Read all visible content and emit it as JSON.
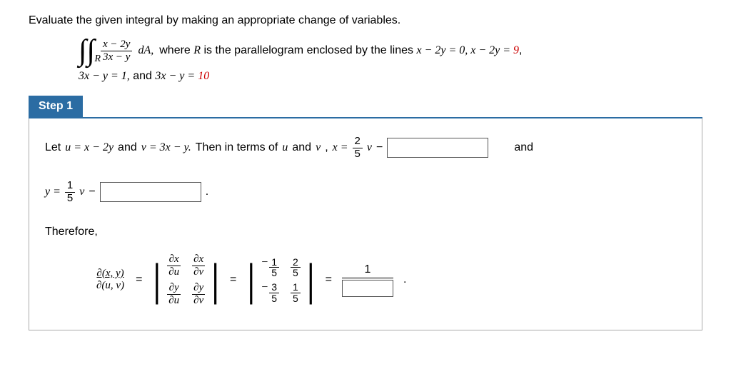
{
  "problem": {
    "lead": "Evaluate the given integral by making an appropriate change of variables.",
    "integrand_num": "x − 2y",
    "integrand_den": "3x − y",
    "int_subscript": "R",
    "dA": "dA,",
    "where_pre": "  where ",
    "where_R": "R",
    "where_mid": " is the parallelogram enclosed by the lines  ",
    "line_a": "x − 2y = 0,   x − 2y = ",
    "line_a_red": "9",
    "line_a_end": ",",
    "line_b_1": "3x − y = 1,",
    "line_b_and": "  and  ",
    "line_b_2": "3x − y = ",
    "line_b_red": "10"
  },
  "step": {
    "label": "Step 1",
    "sentence_pre": "Let ",
    "u_eq": "u = x − 2y",
    "and1": " and ",
    "v_eq": "v = 3x − y.",
    "then": " Then in terms of ",
    "uvword": "u",
    "and2": " and ",
    "vword": "v",
    "comma": ",  ",
    "x_eq_lhs": "x = ",
    "x_coeff_num": "2",
    "x_coeff_den": "5",
    "x_coeff_var": "v",
    "minus": " − ",
    "and3": "and",
    "y_eq_lhs": "y = ",
    "y_coeff_num": "1",
    "y_coeff_den": "5",
    "y_coeff_var": "v",
    "period": " .",
    "therefore": "Therefore,",
    "jac_num": "∂(x, y)",
    "jac_den": "∂(u, v)",
    "eq": " = ",
    "m11_t": "∂x",
    "m11_b": "∂u",
    "m12_t": "∂x",
    "m12_b": "∂v",
    "m21_t": "∂y",
    "m21_b": "∂u",
    "m22_t": "∂y",
    "m22_b": "∂v",
    "v11_n": "1",
    "v11_d": "5",
    "v12_n": "2",
    "v12_d": "5",
    "v21_n": "3",
    "v21_d": "5",
    "v22_n": "1",
    "v22_d": "5",
    "result_top": "1",
    "result_period": "."
  }
}
